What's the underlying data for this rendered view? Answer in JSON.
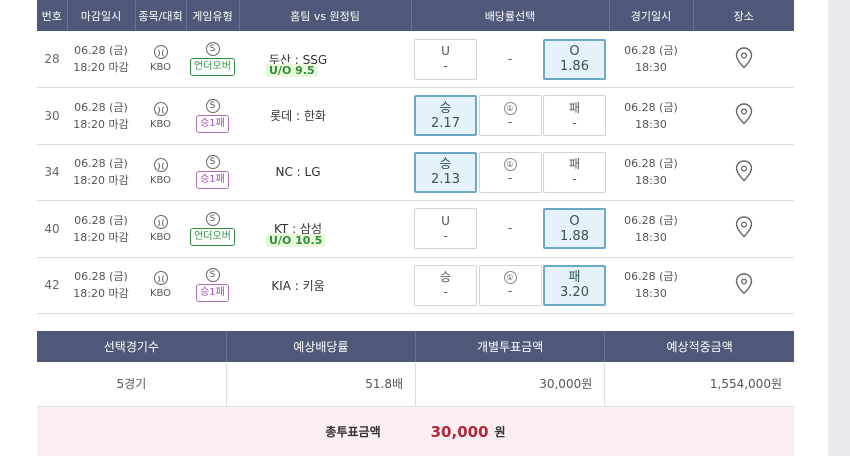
{
  "headers": [
    "번호",
    "마감일시",
    "종목/대회",
    "게임유형",
    "홈팀 vs 원정팀",
    "배당률선택",
    "경기일시",
    "장소"
  ],
  "rows": [
    {
      "num": "28",
      "deadline_date": "06.28 (금)",
      "deadline_time": "18:20 마감",
      "league": "KBO",
      "game_icon": "S",
      "game_type": "언더오버",
      "game_type_color": "green",
      "teams": "두산 : SSG",
      "ou_label": "U/O 9.5",
      "odds": [
        {
          "top": "U",
          "bottom": "-",
          "selected": false
        },
        {
          "top": "-",
          "bottom": "",
          "selected": false,
          "dash": true
        },
        {
          "top": "O",
          "bottom": "1.86",
          "selected": true
        }
      ],
      "game_date": "06.28 (금)",
      "game_time": "18:30"
    },
    {
      "num": "30",
      "deadline_date": "06.28 (금)",
      "deadline_time": "18:20 마감",
      "league": "KBO",
      "game_icon": "S",
      "game_type": "승1패",
      "game_type_color": "purple",
      "teams": "롯데 : 한화",
      "ou_label": "",
      "odds": [
        {
          "top": "승",
          "bottom": "2.17",
          "selected": true
        },
        {
          "top": "①",
          "bottom": "-",
          "selected": false,
          "circle": true
        },
        {
          "top": "패",
          "bottom": "-",
          "selected": false
        }
      ],
      "game_date": "06.28 (금)",
      "game_time": "18:30"
    },
    {
      "num": "34",
      "deadline_date": "06.28 (금)",
      "deadline_time": "18:20 마감",
      "league": "KBO",
      "game_icon": "S",
      "game_type": "승1패",
      "game_type_color": "purple",
      "teams": "NC : LG",
      "ou_label": "",
      "odds": [
        {
          "top": "승",
          "bottom": "2.13",
          "selected": true
        },
        {
          "top": "①",
          "bottom": "-",
          "selected": false,
          "circle": true
        },
        {
          "top": "패",
          "bottom": "-",
          "selected": false
        }
      ],
      "game_date": "06.28 (금)",
      "game_time": "18:30"
    },
    {
      "num": "40",
      "deadline_date": "06.28 (금)",
      "deadline_time": "18:20 마감",
      "league": "KBO",
      "game_icon": "S",
      "game_type": "언더오버",
      "game_type_color": "green",
      "teams": "KT : 삼성",
      "ou_label": "U/O 10.5",
      "odds": [
        {
          "top": "U",
          "bottom": "-",
          "selected": false
        },
        {
          "top": "-",
          "bottom": "",
          "selected": false,
          "dash": true
        },
        {
          "top": "O",
          "bottom": "1.88",
          "selected": true
        }
      ],
      "game_date": "06.28 (금)",
      "game_time": "18:30"
    },
    {
      "num": "42",
      "deadline_date": "06.28 (금)",
      "deadline_time": "18:20 마감",
      "league": "KBO",
      "game_icon": "S",
      "game_type": "승1패",
      "game_type_color": "purple",
      "teams": "KIA : 키움",
      "ou_label": "",
      "odds": [
        {
          "top": "승",
          "bottom": "-",
          "selected": false
        },
        {
          "top": "①",
          "bottom": "-",
          "selected": false,
          "circle": true
        },
        {
          "top": "패",
          "bottom": "3.20",
          "selected": true
        }
      ],
      "game_date": "06.28 (금)",
      "game_time": "18:30"
    }
  ],
  "summary": {
    "headers": [
      "선택경기수",
      "예상배당률",
      "개별투표금액",
      "예상적중금액"
    ],
    "values": [
      "5경기",
      "51.8배",
      "30,000원",
      "1,554,000원"
    ]
  },
  "total": {
    "label": "총투표금액",
    "amount": "30,000",
    "unit": "원"
  },
  "icons": {
    "sport": "baseball-icon",
    "location": "map-pin-icon"
  }
}
